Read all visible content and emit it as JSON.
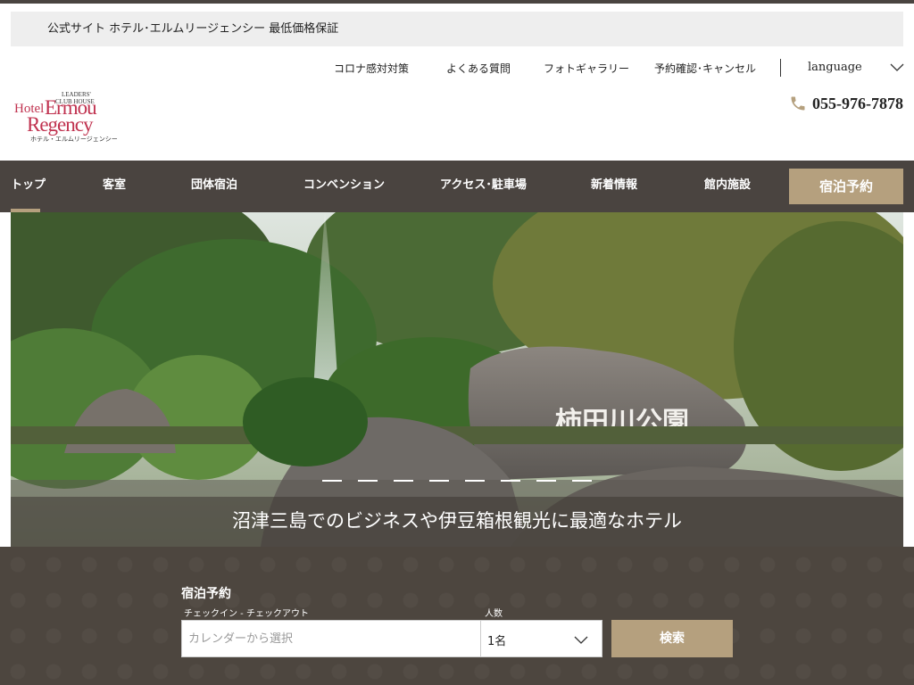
{
  "notice": {
    "text": "公式サイト ホテル･エルムリージェンシー 最低価格保証"
  },
  "utility": {
    "links": [
      "コロナ感対対策",
      "よくある質問",
      "フォトギャラリー",
      "予約確認･キャンセル"
    ],
    "language": "language"
  },
  "logo": {
    "leaders": "LEADERS'",
    "club_house": "CLUB HOUSE",
    "hotel": "Hotel",
    "ermou": "Ermou",
    "regency": "Regency",
    "kana": "ホテル・エルムリージェンシー"
  },
  "phone": {
    "number": "055-976-7878"
  },
  "nav": {
    "items": [
      "トップ",
      "客室",
      "団体宿泊",
      "コンベンション",
      "アクセス･駐車場",
      "新着情報",
      "館内施設"
    ],
    "reserve": "宿泊予約"
  },
  "hero": {
    "stone_text": "柿田川公園",
    "caption": "沼津三島でのビジネスや伊豆箱根観光に最適なホテル",
    "slide_count": 8
  },
  "booking": {
    "title": "宿泊予約",
    "checkin_label": "チェックイン - チェックアウト",
    "date_placeholder": "カレンダーから選択",
    "people_label": "人数",
    "people_value": "1名",
    "search": "検索"
  },
  "colors": {
    "brown": "#4a4440",
    "gold": "#b5a07e",
    "logo": "#c0324f"
  }
}
